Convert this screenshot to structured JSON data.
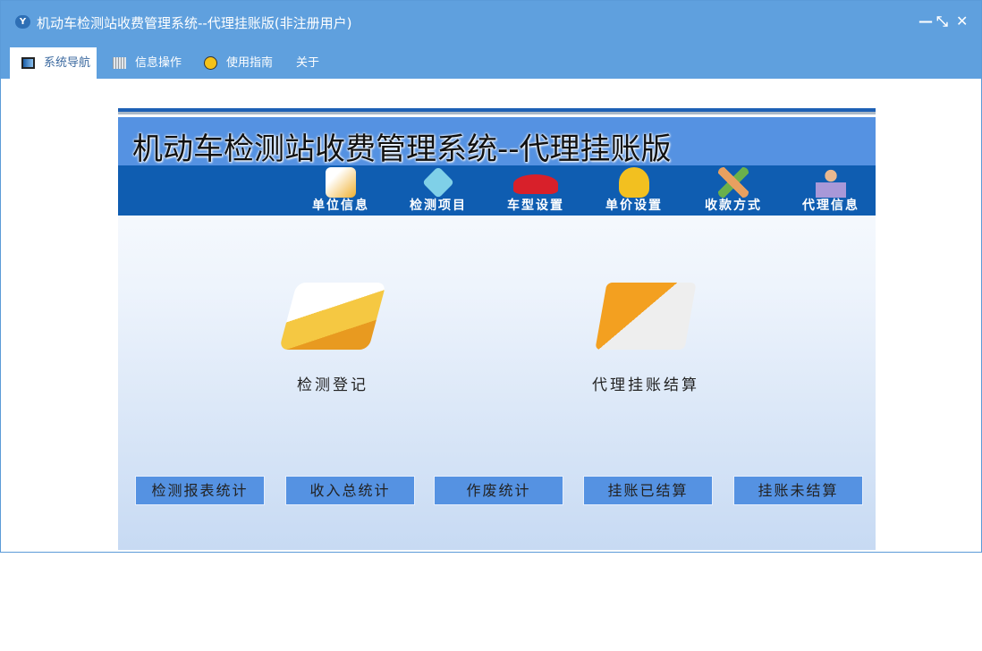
{
  "window": {
    "title": "机动车检测站收费管理系统--代理挂账版(非注册用户)",
    "logo": "Y",
    "minimize": "—",
    "restore": "⤡",
    "close": "✕"
  },
  "tabs": [
    {
      "label": "系统导航",
      "icon": "monitor-icon"
    },
    {
      "label": "信息操作",
      "icon": "grid-icon"
    },
    {
      "label": "使用指南",
      "icon": "help-icon"
    },
    {
      "label": "关于"
    }
  ],
  "banner": {
    "title": "机动车检测站收费管理系统--代理挂账版"
  },
  "nav_items": [
    {
      "label": "单位信息",
      "icon": "building-icon",
      "color": "#f0b030"
    },
    {
      "label": "检测项目",
      "icon": "layers-icon",
      "color": "#7fd0e8"
    },
    {
      "label": "车型设置",
      "icon": "car-icon",
      "color": "#d8202a"
    },
    {
      "label": "单价设置",
      "icon": "coins-icon",
      "color": "#f2c020"
    },
    {
      "label": "收款方式",
      "icon": "pencil-ruler-icon",
      "color": "#e8a060"
    },
    {
      "label": "代理信息",
      "icon": "person-icon",
      "color": "#a898d8"
    }
  ],
  "main_actions": [
    {
      "label": "检测登记",
      "icon": "notebook-pen-icon"
    },
    {
      "label": "代理挂账结算",
      "icon": "laptop-icon"
    }
  ],
  "buttons": [
    "检测报表统计",
    "收入总统计",
    "作废统计",
    "挂账已结算",
    "挂账未结算"
  ]
}
